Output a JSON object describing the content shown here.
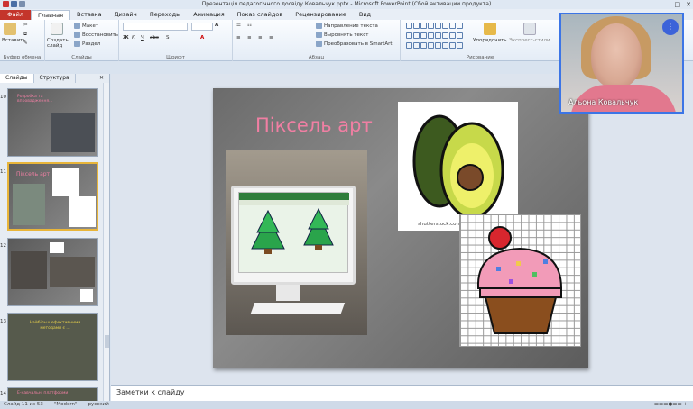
{
  "window": {
    "title": "Презентація педагогічного досвіду Ковальчук.pptx - Microsoft PowerPoint (Сбой активации продукта)"
  },
  "tabs": [
    {
      "label": "Файл"
    },
    {
      "label": "Главная"
    },
    {
      "label": "Вставка"
    },
    {
      "label": "Дизайн"
    },
    {
      "label": "Переходы"
    },
    {
      "label": "Анимация"
    },
    {
      "label": "Показ слайдов"
    },
    {
      "label": "Рецензирование"
    },
    {
      "label": "Вид"
    }
  ],
  "ribbon": {
    "clipboard": {
      "paste": "Вставить",
      "label": "Буфер обмена"
    },
    "slides": {
      "create": "Создать слайд",
      "layout": "Макет",
      "reset": "Восстановить",
      "section": "Раздел",
      "label": "Слайды"
    },
    "font": {
      "label": "Шрифт"
    },
    "paragraph": {
      "direction": "Направление текста",
      "align": "Выровнять текст",
      "smartart": "Преобразовать в SmartArt",
      "label": "Абзац"
    },
    "drawing": {
      "arrange": "Упорядочить",
      "styles": "Экспресс-стили",
      "label": "Рисование"
    }
  },
  "left_panel": {
    "tabs": [
      "Слайды",
      "Структура"
    ],
    "thumbnails": [
      {
        "num": "10",
        "text": "Розробка та впровадження..."
      },
      {
        "num": "11",
        "text": "Піксель арт"
      },
      {
        "num": "12",
        "text": ""
      },
      {
        "num": "13",
        "text": "Найбільш ефективними методами є ..."
      },
      {
        "num": "14",
        "text": "Е-навчальні платформи"
      }
    ]
  },
  "slide": {
    "title": "Піксель арт",
    "watermark": "shutterstock.com"
  },
  "notes": {
    "placeholder": "Заметки к слайду"
  },
  "status": {
    "slide": "Слайд 11 из 53",
    "theme": "\"Modern\"",
    "lang": "русский"
  },
  "video": {
    "name": "Альона Ковальчук"
  }
}
